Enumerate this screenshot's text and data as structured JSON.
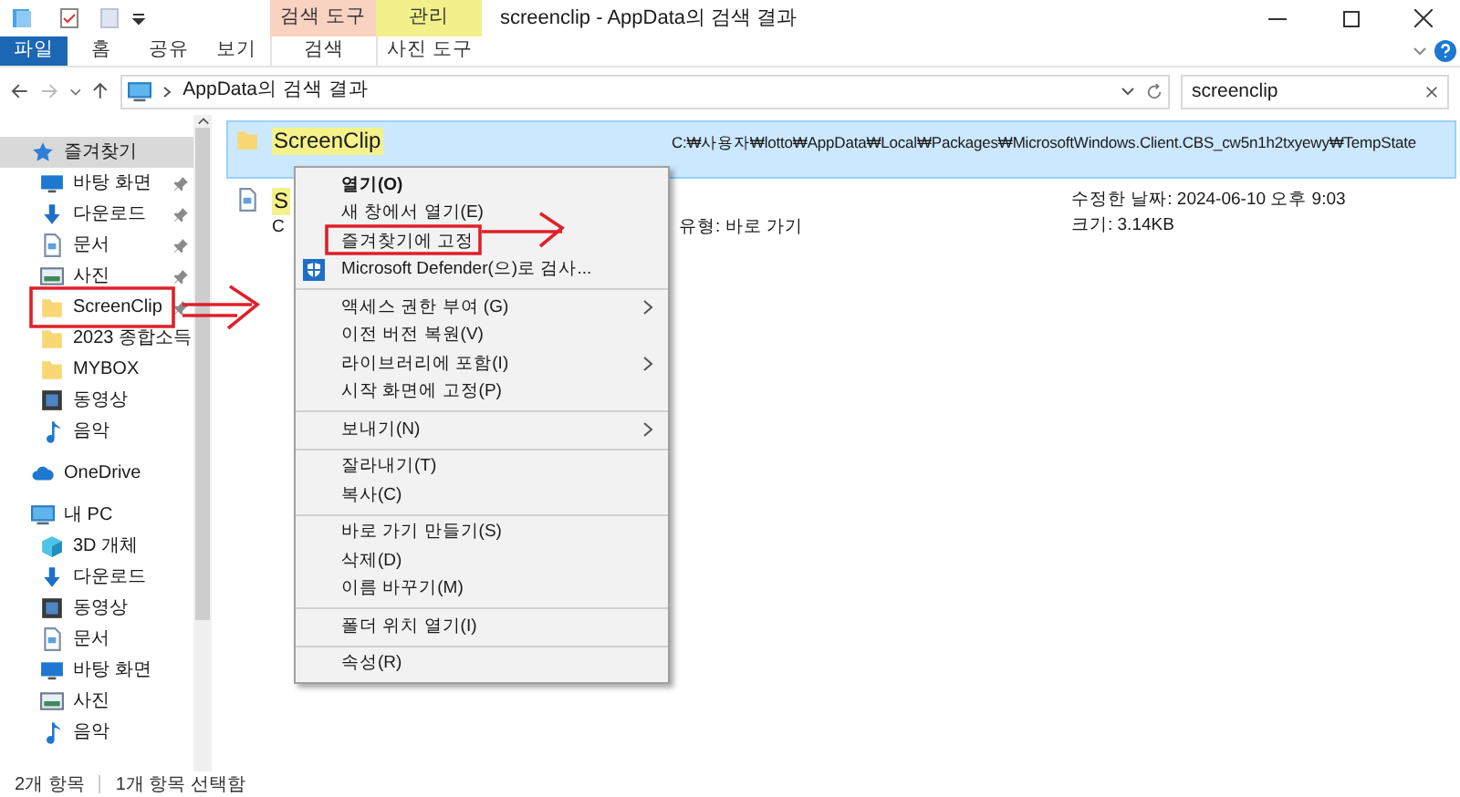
{
  "window": {
    "title": "screenclip - AppData의 검색 결과"
  },
  "ribbon": {
    "context_groups": [
      {
        "label": "검색 도구",
        "color": "#f9d2c2",
        "tabs": [
          {
            "label": "검색",
            "selected": false
          }
        ]
      },
      {
        "label": "관리",
        "color": "#f2f08a",
        "tabs": [
          {
            "label": "사진 도구",
            "selected": false
          }
        ]
      }
    ],
    "tabs": [
      {
        "label": "파일",
        "selected": true
      },
      {
        "label": "홈",
        "selected": false
      },
      {
        "label": "공유",
        "selected": false
      },
      {
        "label": "보기",
        "selected": false
      }
    ]
  },
  "address_bar": {
    "path": "AppData의 검색 결과"
  },
  "search": {
    "value": "screenclip"
  },
  "sidebar": {
    "items": [
      {
        "label": "즐겨찾기",
        "kind": "star",
        "pinned": false,
        "selected": true,
        "children": [
          {
            "label": "바탕 화면",
            "kind": "desktop",
            "pinned": true,
            "selected": false
          },
          {
            "label": "다운로드",
            "kind": "download",
            "pinned": true,
            "selected": false
          },
          {
            "label": "문서",
            "kind": "document",
            "pinned": true,
            "selected": false
          },
          {
            "label": "사진",
            "kind": "picture",
            "pinned": true,
            "selected": false
          },
          {
            "label": "ScreenClip",
            "kind": "folder",
            "pinned": true,
            "selected": false
          },
          {
            "label": "2023 종합소득",
            "kind": "folder",
            "pinned": false,
            "selected": false
          },
          {
            "label": "MYBOX",
            "kind": "folder",
            "pinned": false,
            "selected": false
          },
          {
            "label": "동영상",
            "kind": "video",
            "pinned": false,
            "selected": false
          },
          {
            "label": "음악",
            "kind": "music",
            "pinned": false,
            "selected": false
          }
        ]
      },
      {
        "label": "OneDrive",
        "kind": "cloud",
        "pinned": false,
        "selected": false
      },
      {
        "label": "내 PC",
        "kind": "pc",
        "pinned": false,
        "selected": false,
        "children": [
          {
            "label": "3D 개체",
            "kind": "cube",
            "pinned": false,
            "selected": false
          },
          {
            "label": "다운로드",
            "kind": "download",
            "pinned": false,
            "selected": false
          },
          {
            "label": "동영상",
            "kind": "video",
            "pinned": false,
            "selected": false
          },
          {
            "label": "문서",
            "kind": "document",
            "pinned": false,
            "selected": false
          },
          {
            "label": "바탕 화면",
            "kind": "desktop",
            "pinned": false,
            "selected": false
          },
          {
            "label": "사진",
            "kind": "picture",
            "pinned": false,
            "selected": false
          },
          {
            "label": "음악",
            "kind": "music",
            "pinned": false,
            "selected": false
          }
        ]
      }
    ]
  },
  "results": [
    {
      "name": "ScreenClip",
      "selected": true,
      "path": "C:₩사용자₩lotto₩AppData₩Local₩Packages₩MicrosoftWindows.Client.CBS_cw5n1h2txyewy₩TempState"
    },
    {
      "name": "S",
      "selected": false,
      "subtitle": "C",
      "type": "유형: 바로 가기",
      "modified": "수정한 날짜: 2024-06-10 오후 9:03",
      "size": "크기: 3.14KB"
    }
  ],
  "context_menu": {
    "groups": [
      [
        {
          "label": "열기(O)",
          "bold": true,
          "submenu": false,
          "kind": "plain"
        },
        {
          "label": "새 창에서 열기(E)",
          "bold": false,
          "submenu": false,
          "kind": "plain"
        },
        {
          "label": "즐겨찾기에 고정",
          "bold": false,
          "submenu": false,
          "kind": "plain"
        },
        {
          "label": "Microsoft Defender(으)로 검사...",
          "bold": false,
          "submenu": false,
          "kind": "shield"
        }
      ],
      [
        {
          "label": "액세스 권한 부여 (G)",
          "bold": false,
          "submenu": true,
          "kind": "plain"
        },
        {
          "label": "이전 버전 복원(V)",
          "bold": false,
          "submenu": false,
          "kind": "plain"
        },
        {
          "label": "라이브러리에 포함(I)",
          "bold": false,
          "submenu": true,
          "kind": "plain"
        },
        {
          "label": "시작 화면에 고정(P)",
          "bold": false,
          "submenu": false,
          "kind": "plain"
        }
      ],
      [
        {
          "label": "보내기(N)",
          "bold": false,
          "submenu": true,
          "kind": "plain"
        }
      ],
      [
        {
          "label": "잘라내기(T)",
          "bold": false,
          "submenu": false,
          "kind": "plain"
        },
        {
          "label": "복사(C)",
          "bold": false,
          "submenu": false,
          "kind": "plain"
        }
      ],
      [
        {
          "label": "바로 가기 만들기(S)",
          "bold": false,
          "submenu": false,
          "kind": "plain"
        },
        {
          "label": "삭제(D)",
          "bold": false,
          "submenu": false,
          "kind": "plain"
        },
        {
          "label": "이름 바꾸기(M)",
          "bold": false,
          "submenu": false,
          "kind": "plain"
        }
      ],
      [
        {
          "label": "폴더 위치 열기(I)",
          "bold": false,
          "submenu": false,
          "kind": "plain"
        }
      ],
      [
        {
          "label": "속성(R)",
          "bold": false,
          "submenu": false,
          "kind": "plain"
        }
      ]
    ]
  },
  "status_bar": {
    "count": "2개 항목",
    "selection": "1개 항목 선택함"
  }
}
